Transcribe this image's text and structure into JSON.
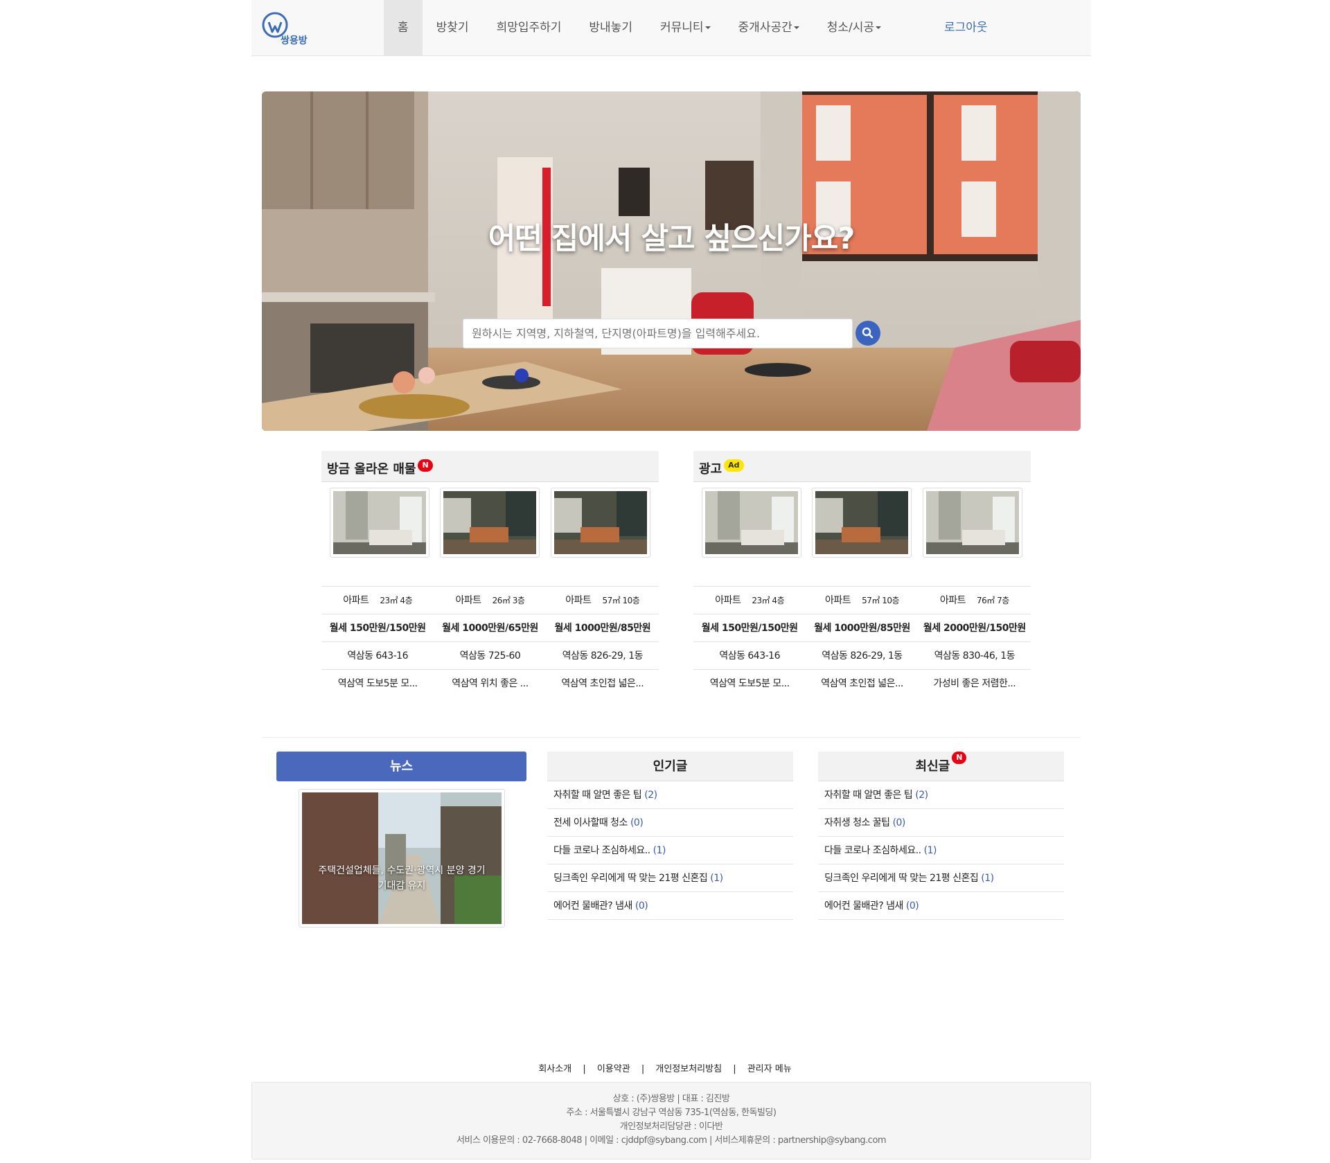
{
  "nav": {
    "logo_text": "쌍용방",
    "items": [
      {
        "label": "홈",
        "active": true,
        "dropdown": false
      },
      {
        "label": "방찾기",
        "active": false,
        "dropdown": false
      },
      {
        "label": "희망입주하기",
        "active": false,
        "dropdown": false
      },
      {
        "label": "방내놓기",
        "active": false,
        "dropdown": false
      },
      {
        "label": "커뮤니티",
        "active": false,
        "dropdown": true
      },
      {
        "label": "중개사공간",
        "active": false,
        "dropdown": true
      },
      {
        "label": "청소/시공",
        "active": false,
        "dropdown": true
      }
    ],
    "logout": "로그아웃"
  },
  "hero": {
    "headline": "어떤 집에서 살고 싶으신가요?",
    "search_placeholder": "원하시는 지역명, 지하철역, 단지명(아파트명)을 입력해주세요."
  },
  "recent": {
    "title": "방금 올라온 매물",
    "badge": "N",
    "listings": [
      {
        "type": "아파트",
        "size": "23㎡ 4층",
        "price": "월세 150만원/150만원",
        "address": "역삼동 643-16",
        "desc": "역삼역 도보5분 모..."
      },
      {
        "type": "아파트",
        "size": "26㎡ 3층",
        "price": "월세 1000만원/65만원",
        "address": "역삼동 725-60",
        "desc": "역삼역 위치 좋은 ..."
      },
      {
        "type": "아파트",
        "size": "57㎡ 10층",
        "price": "월세 1000만원/85만원",
        "address": "역삼동 826-29, 1동",
        "desc": "역삼역 초인접 넓은..."
      }
    ]
  },
  "ads": {
    "title": "광고",
    "badge": "Ad",
    "listings": [
      {
        "type": "아파트",
        "size": "23㎡ 4층",
        "price": "월세 150만원/150만원",
        "address": "역삼동 643-16",
        "desc": "역삼역 도보5분 모..."
      },
      {
        "type": "아파트",
        "size": "57㎡ 10층",
        "price": "월세 1000만원/85만원",
        "address": "역삼동 826-29, 1동",
        "desc": "역삼역 초인접 넓은..."
      },
      {
        "type": "아파트",
        "size": "76㎡ 7층",
        "price": "월세 2000만원/150만원",
        "address": "역삼동 830-46, 1동",
        "desc": "가성비 좋은 저렴한..."
      }
    ]
  },
  "news": {
    "title": "뉴스",
    "caption": "주택건설업체들, 수도권·광역시 분양 경기 기대감 유지"
  },
  "popular": {
    "title": "인기글",
    "items": [
      {
        "text": "자취할 때 알면 좋은 팁",
        "count": "(2)"
      },
      {
        "text": "전세 이사할때 청소",
        "count": "(0)"
      },
      {
        "text": "다들 코로나 조심하세요..",
        "count": "(1)"
      },
      {
        "text": "딩크족인 우리에게 딱 맞는 21평 신혼집",
        "count": "(1)"
      },
      {
        "text": "에어컨 물배관? 냄새",
        "count": "(0)"
      }
    ]
  },
  "latest": {
    "title": "최신글",
    "badge": "N",
    "items": [
      {
        "text": "자취할 때 알면 좋은 팁",
        "count": "(2)"
      },
      {
        "text": "자취생 청소 꿀팁",
        "count": "(0)"
      },
      {
        "text": "다들 코로나 조심하세요..",
        "count": "(1)"
      },
      {
        "text": "딩크족인 우리에게 딱 맞는 21평 신혼집",
        "count": "(1)"
      },
      {
        "text": "에어컨 물배관? 냄새",
        "count": "(0)"
      }
    ]
  },
  "footer": {
    "links": [
      "회사소개",
      "이용약관",
      "개인정보처리방침",
      "관리자 메뉴"
    ],
    "separator": "|",
    "lines": [
      "상호 : (주)쌍용방 | 대표 : 김진방",
      "주소 : 서울특별시 강남구 역삼동 735-1(역삼동, 한독빌딩)",
      "개인정보처리담당관 : 이다반",
      "서비스 이용문의 : 02-7668-8048 | 이메일 : cjddpf@sybang.com | 서비스제휴문의 : partnership@sybang.com"
    ]
  },
  "colors": {
    "accent": "#4a69bd",
    "link": "#3a6db5",
    "badge_new": "#e60012",
    "badge_ad": "#ffe600"
  }
}
